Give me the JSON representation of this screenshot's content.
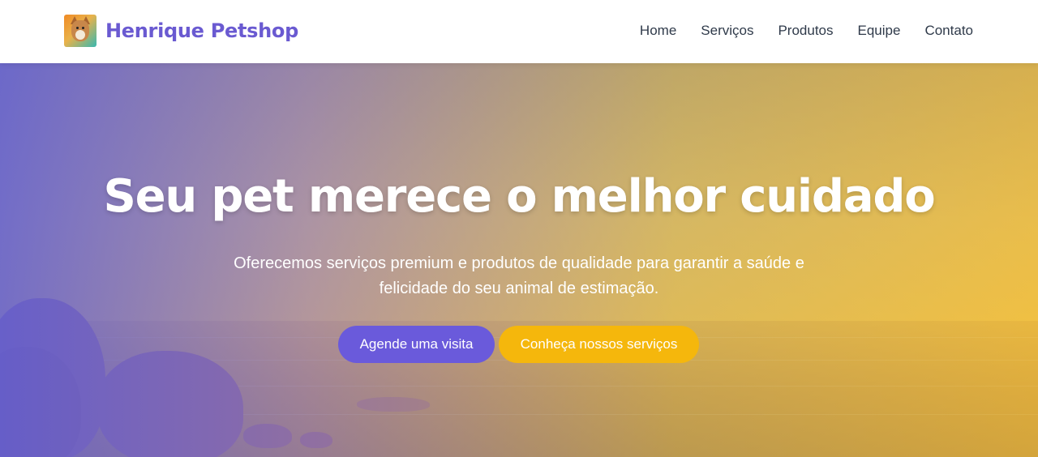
{
  "header": {
    "brand_name": "Henrique Petshop",
    "logo_icon": "dog-logo-icon",
    "nav": [
      {
        "label": "Home"
      },
      {
        "label": "Serviços"
      },
      {
        "label": "Produtos"
      },
      {
        "label": "Equipe"
      },
      {
        "label": "Contato"
      }
    ]
  },
  "hero": {
    "title": "Seu pet merece o melhor cuidado",
    "subtitle": "Oferecemos serviços premium e produtos de qualidade para garantir a saúde e felicidade do seu animal de estimação.",
    "primary_button": "Agende uma visita",
    "secondary_button": "Conheça nossos serviços"
  },
  "colors": {
    "brand": "#6a5ad1",
    "primary_button": "#6a5adb",
    "secondary_button": "#f5b70c",
    "nav_text": "#2f3a4a"
  }
}
